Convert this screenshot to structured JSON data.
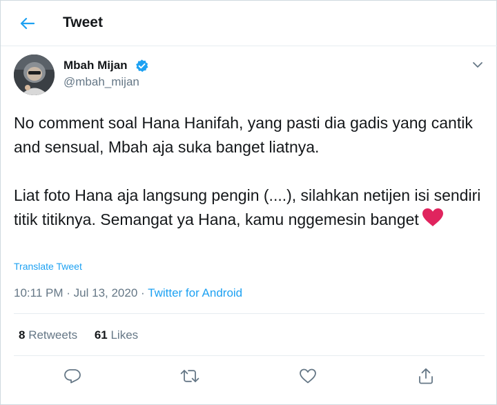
{
  "header": {
    "title": "Tweet",
    "back_icon": "back-arrow-icon"
  },
  "author": {
    "display_name": "Mbah Mijan",
    "handle": "@mbah_mijan",
    "verified": true
  },
  "tweet": {
    "paragraph_1": "No comment soal Hana Hanifah, yang pasti dia gadis yang cantik and sensual, Mbah aja suka banget liatnya.",
    "paragraph_2": "Liat foto Hana aja langsung pengin (....), silahkan netijen isi sendiri titik titiknya. Semangat ya Hana, kamu nggemesin banget",
    "translate_label": "Translate Tweet",
    "time": "10:11 PM",
    "date": "Jul 13, 2020",
    "separator": "·",
    "source": "Twitter for Android"
  },
  "stats": {
    "retweets_count": "8",
    "retweets_label": "Retweets",
    "likes_count": "61",
    "likes_label": "Likes"
  },
  "actions": [
    "reply-icon",
    "retweet-icon",
    "like-icon",
    "share-icon"
  ],
  "colors": {
    "accent": "#1da1f2",
    "text": "#14171a",
    "muted": "#657786",
    "heart": "#e0245e",
    "border": "#e6ecf0"
  }
}
